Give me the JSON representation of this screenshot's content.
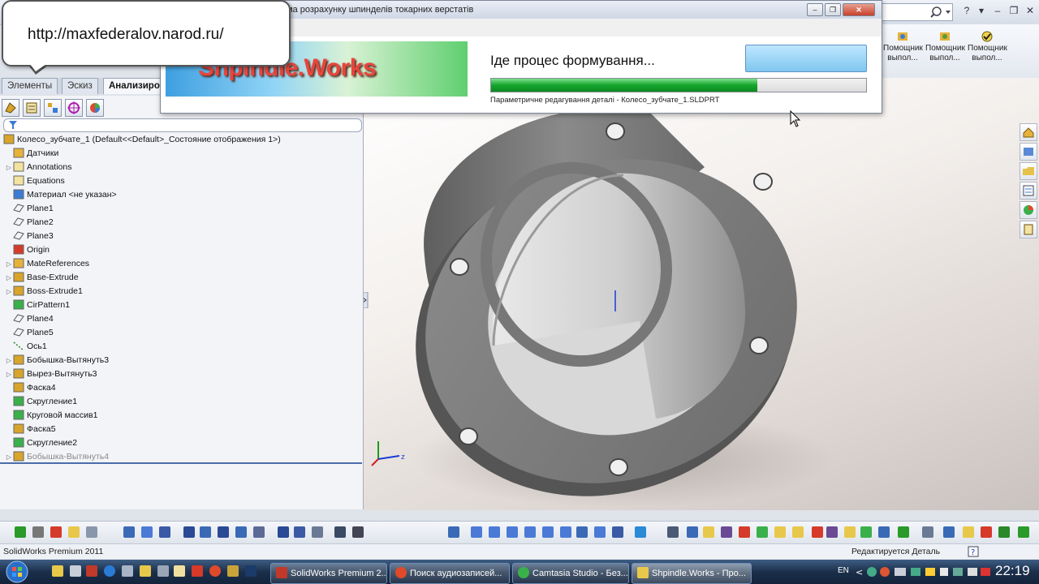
{
  "callout": {
    "url": "http://maxfederalov.narod.ru/"
  },
  "tabs": [
    {
      "label": "Элементы"
    },
    {
      "label": "Эскиз"
    },
    {
      "label": "Анализиров"
    }
  ],
  "help_buttons": [
    {
      "label": "Помощник выпол..."
    },
    {
      "label": "Помощник выпол..."
    },
    {
      "label": "Помощник выпол..."
    }
  ],
  "dialog": {
    "title": "ма розрахунку шпинделів токарних верстатів",
    "logo": "Shpindle.Works",
    "status": "Іде процес формування...",
    "progress_percent": 71,
    "substatus": "Параметричне редагування деталі - Колесо_зубчате_1.SLDPRT"
  },
  "tree": {
    "root": "Колесо_зубчате_1  (Default<<Default>_Состояние отображения 1>)",
    "items": [
      {
        "label": "Датчики",
        "icon": "sensor-icon",
        "exp": false
      },
      {
        "label": "Annotations",
        "icon": "annotation-icon",
        "exp": true
      },
      {
        "label": "Equations",
        "icon": "equation-icon",
        "exp": false
      },
      {
        "label": "Материал <не указан>",
        "icon": "material-icon",
        "exp": false
      },
      {
        "label": "Plane1",
        "icon": "plane-icon",
        "exp": false
      },
      {
        "label": "Plane2",
        "icon": "plane-icon",
        "exp": false
      },
      {
        "label": "Plane3",
        "icon": "plane-icon",
        "exp": false
      },
      {
        "label": "Origin",
        "icon": "origin-icon",
        "exp": false
      },
      {
        "label": "MateReferences",
        "icon": "folder-icon",
        "exp": true
      },
      {
        "label": "Base-Extrude",
        "icon": "extrude-icon",
        "exp": true
      },
      {
        "label": "Boss-Extrude1",
        "icon": "extrude-icon",
        "exp": true
      },
      {
        "label": "CirPattern1",
        "icon": "pattern-icon",
        "exp": false
      },
      {
        "label": "Plane4",
        "icon": "plane-icon",
        "exp": false
      },
      {
        "label": "Plane5",
        "icon": "plane-icon",
        "exp": false
      },
      {
        "label": "Ось1",
        "icon": "axis-icon",
        "exp": false
      },
      {
        "label": "Бобышка-Вытянуть3",
        "icon": "extrude-icon",
        "exp": true
      },
      {
        "label": "Вырез-Вытянуть3",
        "icon": "extrude-icon",
        "exp": true
      },
      {
        "label": "Фаска4",
        "icon": "chamfer-icon",
        "exp": false
      },
      {
        "label": "Скругление1",
        "icon": "fillet-icon",
        "exp": false
      },
      {
        "label": "Круговой массив1",
        "icon": "pattern-icon",
        "exp": false
      },
      {
        "label": "Фаска5",
        "icon": "chamfer-icon",
        "exp": false
      },
      {
        "label": "Скругление2",
        "icon": "fillet-icon",
        "exp": false
      },
      {
        "label": "Бобышка-Вытянуть4",
        "icon": "extrude-icon",
        "exp": true
      }
    ]
  },
  "statusbar": {
    "left": "SolidWorks Premium 2011",
    "right": "Редактируется Деталь"
  },
  "taskbar": {
    "items": [
      {
        "label": "SolidWorks Premium 2..."
      },
      {
        "label": "Поиск аудиозаписей..."
      },
      {
        "label": "Camtasia Studio - Без..."
      },
      {
        "label": "Shpindle.Works - Про..."
      }
    ],
    "lang": "EN",
    "clock": "22:19"
  }
}
